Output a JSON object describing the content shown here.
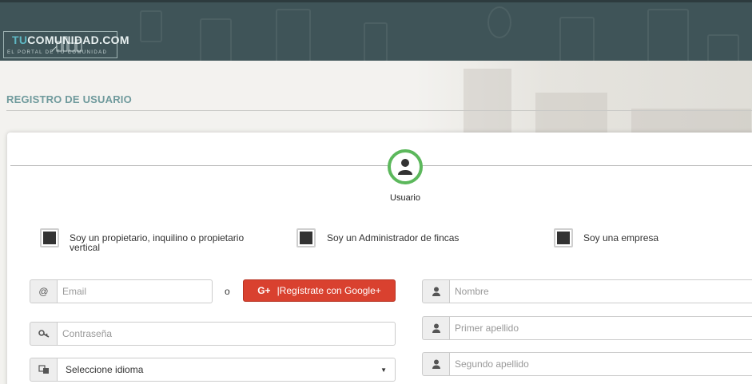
{
  "header": {
    "logo_main_prefix": "TU",
    "logo_main_rest": "COMUNIDAD.COM",
    "logo_sub": "EL PORTAL DE TU COMUNIDAD"
  },
  "page": {
    "title": "REGISTRO DE USUARIO"
  },
  "step": {
    "label": "Usuario"
  },
  "user_types": [
    {
      "label": "Soy un propietario, inquilino o propietario vertical",
      "checked": false
    },
    {
      "label": "Soy un Administrador de fincas",
      "checked": false
    },
    {
      "label": "Soy una empresa",
      "checked": false
    }
  ],
  "form": {
    "email_addon": "@",
    "email_placeholder": "Email",
    "or_text": "o",
    "google_icon": "G+",
    "google_label": "|Regístrate con Google+",
    "password_placeholder": "Contraseña",
    "language_selected": "Seleccione idioma",
    "nombre_placeholder": "Nombre",
    "primer_apellido_placeholder": "Primer apellido",
    "segundo_apellido_placeholder": "Segundo apellido"
  },
  "colors": {
    "header_bg": "#3f5458",
    "accent_green": "#5cb85c",
    "google_red": "#d9412f",
    "title_teal": "#6f9a9c"
  }
}
